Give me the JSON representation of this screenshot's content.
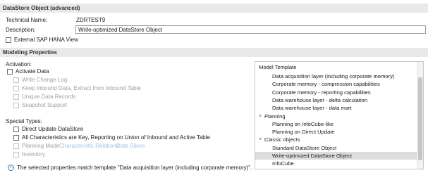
{
  "sections": {
    "datastore_header": "DataStore Object (advanced)",
    "modeling_header": "Modeling Properties"
  },
  "general": {
    "technical_name_label": "Technical Name:",
    "technical_name_value": "ZDRTEST9",
    "description_label": "Description:",
    "description_value": "Write-optimized DataStore Object",
    "external_hana_view_label": "External SAP HANA View"
  },
  "activation": {
    "heading": "Activation:",
    "activate_data_label": "Activate Data",
    "write_change_log_label": "Write Change Log",
    "keep_inbound_label": "Keep Inbound Data, Extract from Inbound Table",
    "unique_records_label": "Unique Data Records",
    "snapshot_support_label": "Snapshot Support"
  },
  "special_types": {
    "heading": "Special Types:",
    "direct_update_label": "Direct Update DataStore",
    "all_characteristics_label": "All Characteristics are Key, Reporting on Union of Inbound and Active Table",
    "planning_mode_label": "Planning Mode",
    "characteristic_relations_link": "Characteristic Relations",
    "data_slices_link": "Data Slices",
    "inventory_label": "Inventory"
  },
  "info": {
    "message": "The selected properties match template \"Data acquisition layer (including corporate memory)\"."
  },
  "model_template": {
    "title": "Model Template",
    "items": [
      {
        "label": "Data acquisition layer (including corporate memory)",
        "kind": "leaf"
      },
      {
        "label": "Corporate memory - compression capabilities",
        "kind": "leaf"
      },
      {
        "label": "Corporate memory - reporting capabilities",
        "kind": "leaf"
      },
      {
        "label": "Data warehouse layer - delta calculation",
        "kind": "leaf"
      },
      {
        "label": "Data warehouse layer - data mart",
        "kind": "leaf"
      },
      {
        "label": "Planning",
        "kind": "group"
      },
      {
        "label": "Planning on InfoCube-like",
        "kind": "leaf"
      },
      {
        "label": "Planning on Direct Update",
        "kind": "leaf"
      },
      {
        "label": "Classic objects",
        "kind": "group"
      },
      {
        "label": "Standard DataStore Object",
        "kind": "leaf"
      },
      {
        "label": "Write-optimized DataStore Object",
        "kind": "leaf",
        "selected": true
      },
      {
        "label": "InfoCube",
        "kind": "leaf"
      }
    ]
  }
}
